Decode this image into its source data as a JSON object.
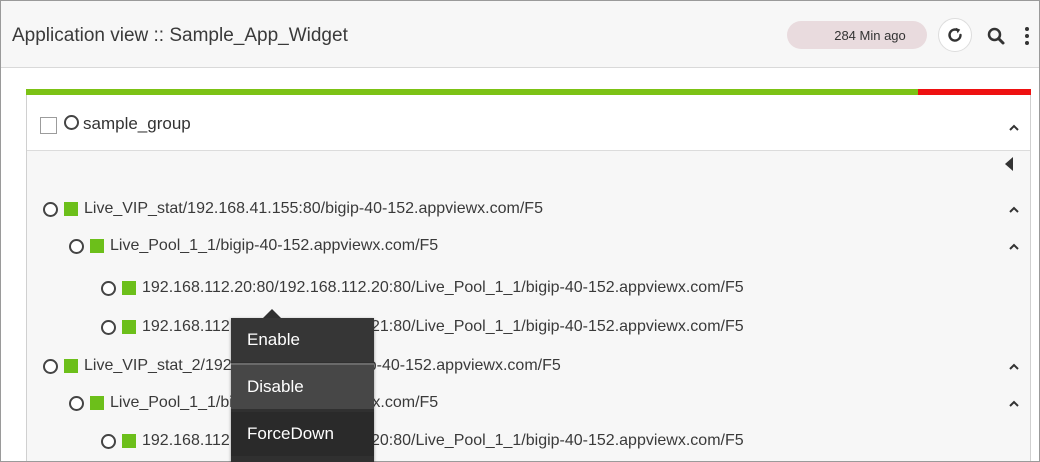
{
  "header": {
    "title": "Application view :: Sample_App_Widget",
    "time_ago": "284 Min ago"
  },
  "colors": {
    "health_green": "#7cc215",
    "health_red": "#ee1111",
    "status_square": "#6cbf1a",
    "menu_bg": "#303030"
  },
  "group": {
    "name": "sample_group",
    "checked": false
  },
  "tree": [
    {
      "label": "Live_VIP_stat/192.168.41.155:80/bigip-40-152.appviewx.com/F5",
      "level": 0,
      "expandable": true
    },
    {
      "label": "Live_Pool_1_1/bigip-40-152.appviewx.com/F5",
      "level": 1,
      "expandable": true
    },
    {
      "label": "192.168.112.20:80/192.168.112.20:80/Live_Pool_1_1/bigip-40-152.appviewx.com/F5",
      "level": 2,
      "expandable": false
    },
    {
      "label": "192.168.112.21:80/192.168.112.21:80/Live_Pool_1_1/bigip-40-152.appviewx.com/F5",
      "level": 2,
      "expandable": false
    },
    {
      "label": "Live_VIP_stat_2/192.168.41.156:80/bigip-40-152.appviewx.com/F5",
      "level": 0,
      "expandable": true
    },
    {
      "label": "Live_Pool_1_1/bigip-40-152.appviewx.com/F5",
      "level": 1,
      "expandable": true
    },
    {
      "label": "192.168.112.20:80/192.168.112.20:80/Live_Pool_1_1/bigip-40-152.appviewx.com/F5",
      "level": 2,
      "expandable": false
    }
  ],
  "context_menu": {
    "items": [
      "Enable",
      "Disable",
      "ForceDown"
    ]
  },
  "icons": {
    "refresh": "refresh-icon",
    "search": "search-icon",
    "more": "more-vertical-icon",
    "collapse_group": "chevron-up-icon",
    "collapse_sidebar": "caret-left-icon"
  }
}
